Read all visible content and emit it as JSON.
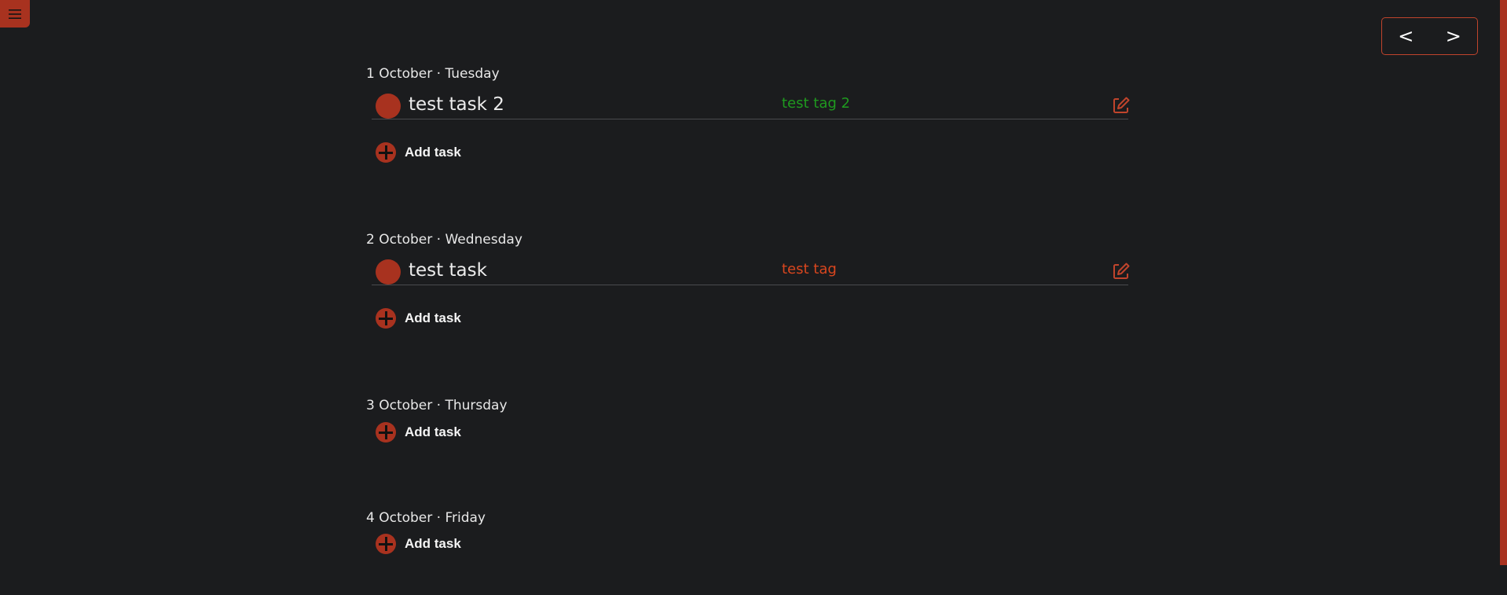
{
  "menu": {
    "icon": "hamburger-menu-icon"
  },
  "navigation": {
    "prev_label": "<",
    "next_label": ">"
  },
  "colors": {
    "accent": "#a8321f",
    "tag_green": "#1f9a1f",
    "tag_orange": "#d9461e"
  },
  "days": [
    {
      "title": "1 October · Tuesday",
      "tasks": [
        {
          "name": "test task 2",
          "tag": "test tag 2",
          "tag_color": "#1f9a1f"
        }
      ],
      "add_label": "Add task"
    },
    {
      "title": "2 October · Wednesday",
      "tasks": [
        {
          "name": "test task",
          "tag": "test tag",
          "tag_color": "#d9461e"
        }
      ],
      "add_label": "Add task"
    },
    {
      "title": "3 October · Thursday",
      "tasks": [],
      "add_label": "Add task"
    },
    {
      "title": "4 October · Friday",
      "tasks": [],
      "add_label": "Add task"
    }
  ]
}
